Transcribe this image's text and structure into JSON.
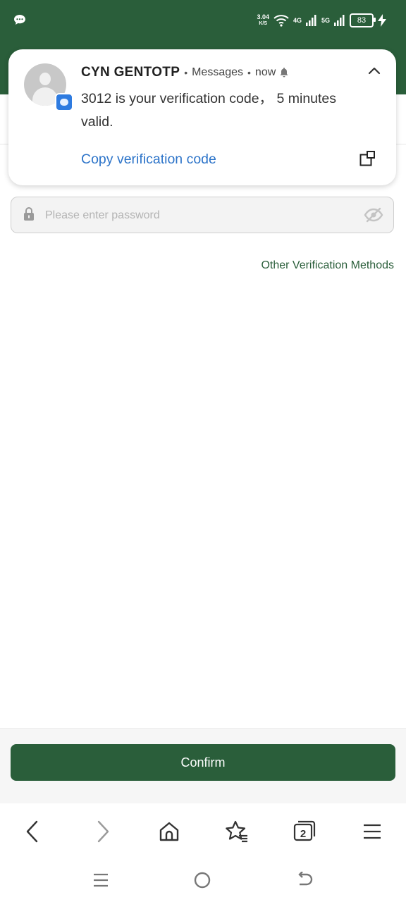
{
  "status_bar": {
    "speed_value": "3.04",
    "speed_unit": "K/S",
    "net1": "4G",
    "net2": "5G",
    "battery": "83",
    "icons": [
      "chat-bubble-icon",
      "wifi-icon",
      "signal-icon",
      "battery-icon",
      "charging-icon"
    ]
  },
  "notification": {
    "sender": "CYN GENTOTP",
    "app": "Messages",
    "time": "now",
    "body": "3012 is your verification code， 5 minutes valid.",
    "action_label": "Copy verification code"
  },
  "password": {
    "placeholder": "Please enter password"
  },
  "other_methods_label": "Other Verification Methods",
  "confirm_label": "Confirm",
  "browser_bar": {
    "tabs_count": "2",
    "icons": [
      "back-icon",
      "forward-icon",
      "home-icon",
      "bookmarks-icon",
      "tabs-icon",
      "menu-icon"
    ]
  },
  "system_nav": {
    "icons": [
      "recents-icon",
      "home-circle-icon",
      "back-nav-icon"
    ]
  },
  "colors": {
    "brand_green": "#2a5e3a",
    "link_blue": "#2d74c9"
  }
}
